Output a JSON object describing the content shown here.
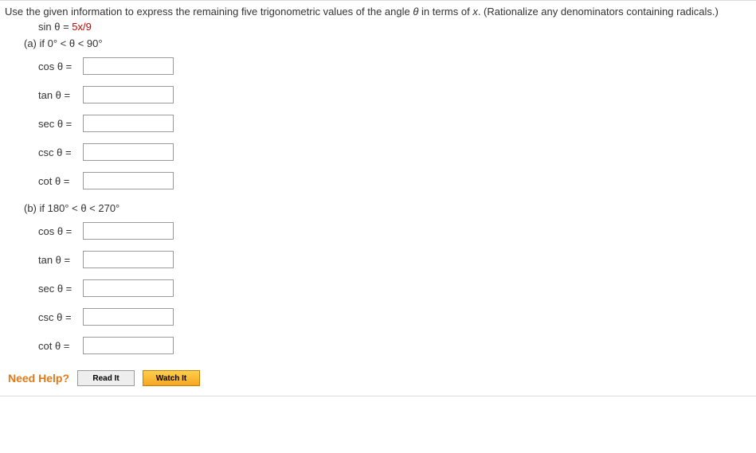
{
  "prompt": {
    "text_before_theta": "Use the given information to express the remaining five trigonometric values of the angle ",
    "theta": "θ",
    "text_after_theta": " in terms of ",
    "var": "x",
    "text_end": ". (Rationalize any denominators containing radicals.)"
  },
  "given": {
    "lhs": "sin θ = ",
    "rhs": "5x/9"
  },
  "parts": {
    "a": {
      "heading": "(a) if 0° < θ < 90°",
      "funcs": {
        "cos": "cos θ  =",
        "tan": "tan θ  =",
        "sec": "sec θ  =",
        "csc": "csc θ  =",
        "cot": "cot θ  ="
      }
    },
    "b": {
      "heading": "(b) if 180° < θ < 270°",
      "funcs": {
        "cos": "cos θ  =",
        "tan": "tan θ  =",
        "sec": "sec θ  =",
        "csc": "csc θ  =",
        "cot": "cot θ  ="
      }
    }
  },
  "help": {
    "label": "Need Help?",
    "read": "Read It",
    "watch": "Watch It"
  }
}
